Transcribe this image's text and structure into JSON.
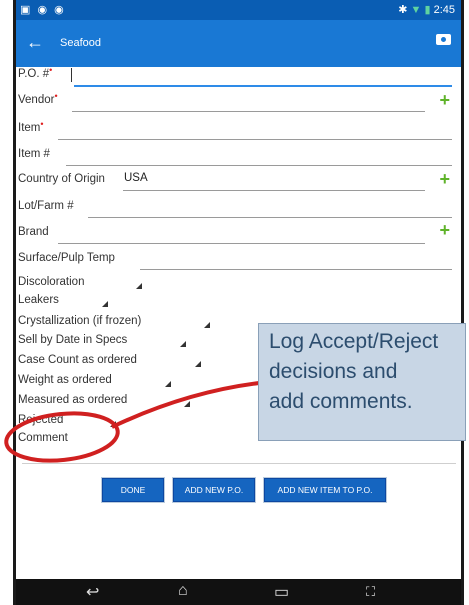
{
  "statusbar": {
    "left_icons": "▣ ◉ ◉",
    "time": "2:45"
  },
  "appbar": {
    "back_glyph": "←",
    "title": "Seafood"
  },
  "fields": [
    {
      "label": "P.O. #",
      "required": true,
      "value": ""
    },
    {
      "label": "Vendor",
      "required": true,
      "value": "",
      "add": true
    },
    {
      "label": "Item",
      "required": true,
      "value": ""
    },
    {
      "label": "Item #",
      "required": false,
      "value": ""
    },
    {
      "label": "Country of Origin",
      "required": false,
      "value": "USA",
      "add": true
    },
    {
      "label": "Lot/Farm #",
      "required": false,
      "value": ""
    },
    {
      "label": "Brand",
      "required": false,
      "value": "",
      "add": true
    },
    {
      "label": "Surface/Pulp Temp",
      "required": false,
      "value": ""
    }
  ],
  "dropdowns": [
    "Discoloration",
    "Leakers",
    "Crystallization (if frozen)",
    "Sell by Date in Specs",
    "Case Count as ordered",
    "Weight as ordered",
    "Measured as ordered",
    "Rejected"
  ],
  "comment_label": "Comment",
  "buttons": {
    "done": "DONE",
    "add_po": "ADD NEW P.O.",
    "add_item": "ADD NEW ITEM TO P.O."
  },
  "plus_glyph": "+",
  "navbar": {
    "back": "↩",
    "home": "⌂",
    "recent": "▭",
    "expand": "⛶"
  },
  "callout": {
    "line1": "Log Accept/Reject",
    "line2": "decisions and",
    "line3": "add comments."
  },
  "colors": {
    "statusbar": "#0a5db3",
    "appbar": "#1978d4",
    "button": "#1565c0",
    "plus": "#5fb32a",
    "callout_bg": "#c8d6e5",
    "annotation": "#d02020"
  }
}
